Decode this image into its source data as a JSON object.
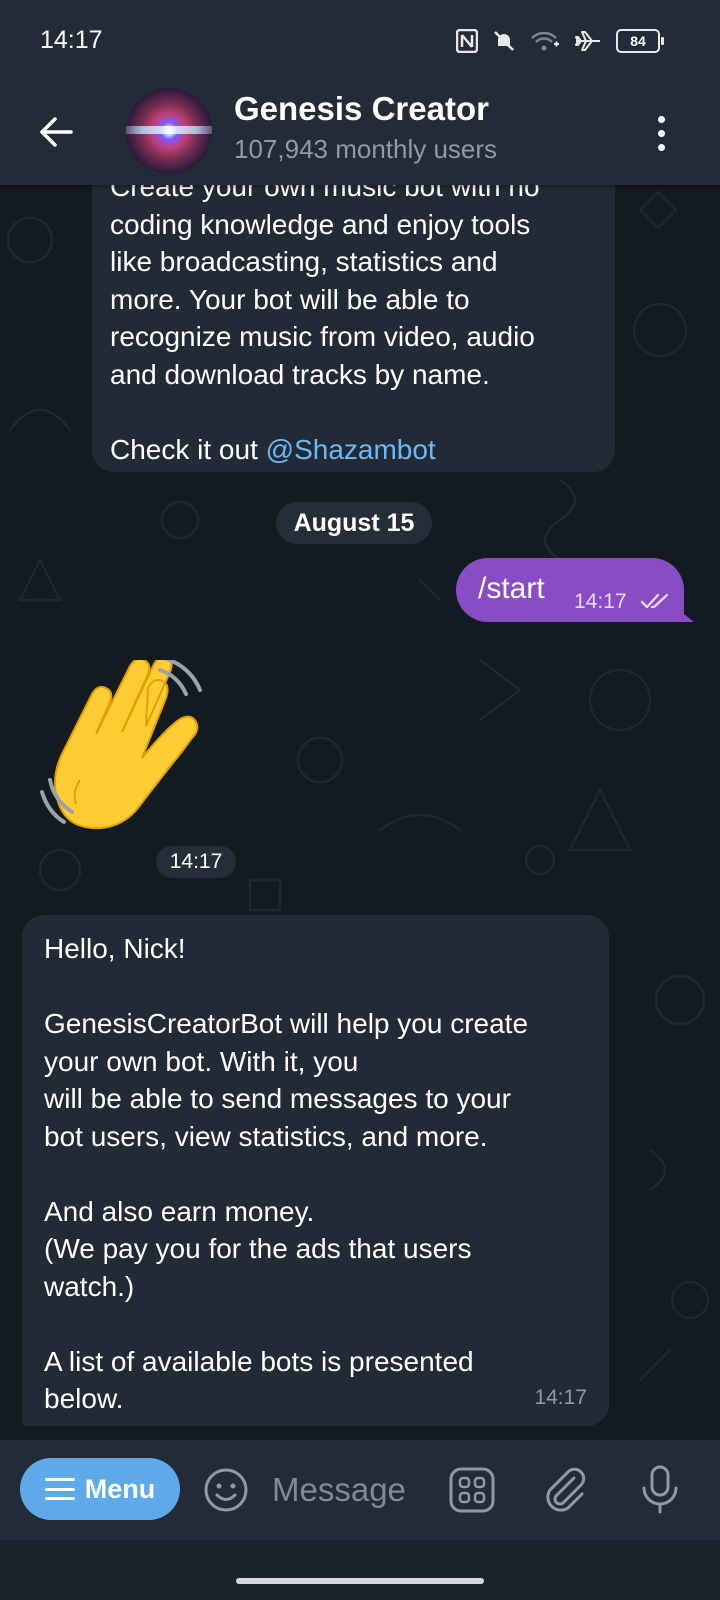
{
  "status_bar": {
    "time": "14:17",
    "battery": "84"
  },
  "header": {
    "title": "Genesis Creator",
    "subtitle": "107,943 monthly users"
  },
  "messages": {
    "first": {
      "text": "Create your own music bot with no\ncoding knowledge and enjoy tools\nlike broadcasting, statistics and\nmore. Your bot will be able to\nrecognize music from video, audio\nand download tracks by name.\n\nCheck it out ",
      "link": "@Shazambot"
    },
    "date_separator": "August 15",
    "outgoing": {
      "text": "/start",
      "time": "14:17"
    },
    "sticker": {
      "emoji": "👋",
      "time": "14:17"
    },
    "welcome": {
      "text": "Hello, Nick!\n\nGenesisCreatorBot will help you create\nyour own bot. With it, you\nwill be able to send messages to your\nbot users, view statistics, and more.\n\nAnd also earn money.\n(We pay you for the ads that users\nwatch.)\n\nA list of available bots is presented\nbelow.",
      "time": "14:17"
    }
  },
  "input_bar": {
    "menu_label": "Menu",
    "placeholder": "Message"
  },
  "colors": {
    "outgoing_bubble": "#8a4cc2",
    "menu_button": "#5eaae8",
    "link": "#6cb8f5"
  }
}
